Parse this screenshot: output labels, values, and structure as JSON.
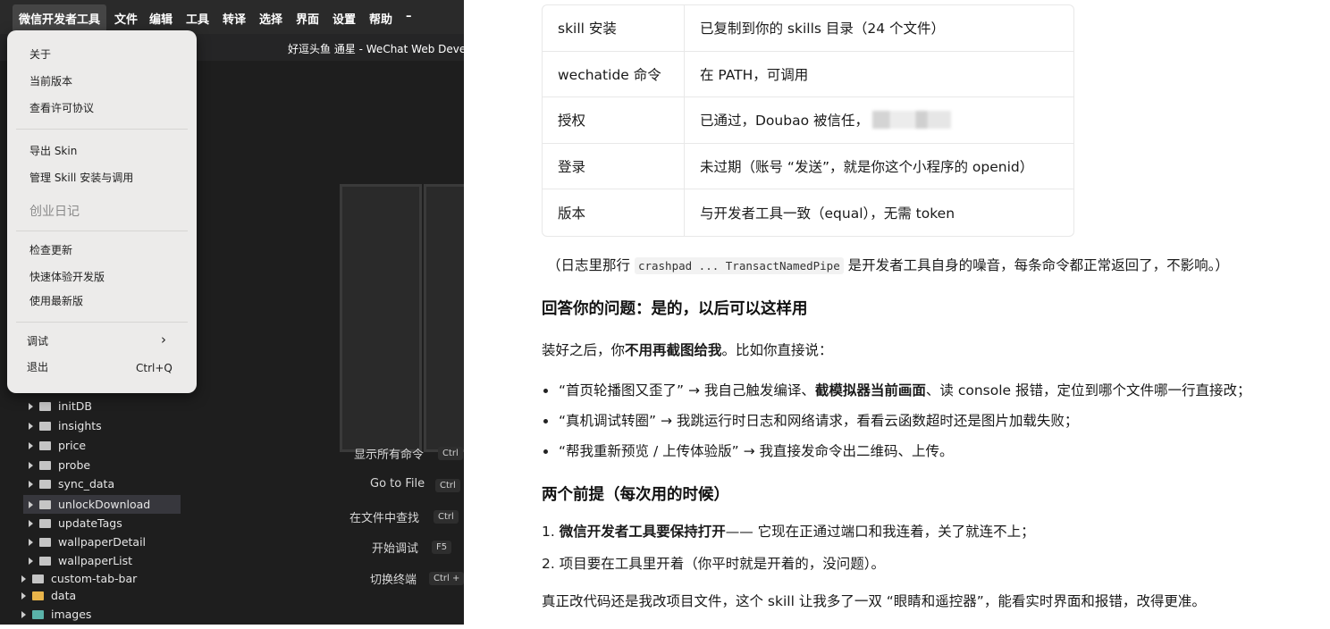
{
  "devtools": {
    "menubar": {
      "items": [
        "微信开发者工具",
        "文件",
        "编辑",
        "工具",
        "转译",
        "选择",
        "界面",
        "设置",
        "帮助",
        "–"
      ]
    },
    "window_title": "好逗头鱼 通星 - WeChat Web Devel",
    "dropdown": {
      "about": "关于",
      "current_version": "当前版本",
      "license": "查看许可协议",
      "export_skin": "导出 Skin",
      "manage_skill": "管理 Skill 安装与调用",
      "disabled_item": "创业日记",
      "check_updates": "检查更新",
      "quick_dev": "快速体验开发版",
      "use_latest": "使用最新版",
      "debug": "调试",
      "debug_arrow": "›",
      "quit": "退出",
      "quit_shortcut": "Ctrl+Q"
    },
    "commands": [
      {
        "label": "显示所有命令",
        "key": "Ctrl"
      },
      {
        "label": "Go to File",
        "key": "Ctrl"
      },
      {
        "label": "在文件中查找",
        "key": "Ctrl"
      },
      {
        "label": "开始调试",
        "key": "F5"
      },
      {
        "label": "切换终端",
        "key": "Ctrl +"
      }
    ],
    "file_tree": [
      "initDB",
      "insights",
      "price",
      "probe",
      "sync_data",
      "unlockDownload",
      "updateTags",
      "wallpaperDetail",
      "wallpaperList",
      "custom-tab-bar",
      "data",
      "images"
    ],
    "selected_item": "unlockDownload"
  },
  "chat": {
    "table": [
      {
        "key": "skill 安装",
        "value": "已复制到你的 skills 目录（24 个文件）"
      },
      {
        "key": "wechatide 命令",
        "value": "在 PATH，可调用"
      },
      {
        "key": "授权",
        "value": "已通过，Doubao 被信任，"
      },
      {
        "key": "登录",
        "value": "未过期（账号 “发送”，就是你这个小程序的 openid）"
      },
      {
        "key": "版本",
        "value": "与开发者工具一致（equal），无需 token"
      }
    ],
    "log_note": {
      "prefix": "（日志里那行",
      "code": "crashpad ... TransactNamedPipe",
      "suffix": "是开发者工具自身的噪音，每条命令都正常返回了，不影响。）"
    },
    "heading1": "回答你的问题：是的，以后可以这样用",
    "intro": {
      "a": "装好之后，你",
      "b": "不用再截图给我",
      "c": "。比如你直接说："
    },
    "bullets": [
      {
        "a": "“首页轮播图又歪了” → 我自己触发编译、",
        "b": "截模拟器当前画面",
        "c": "、读 console 报错，定位到哪个文件哪一行直接改；"
      },
      {
        "a": "“真机调试转圈” → 我跳运行时日志和网络请求，看看云函数超时还是图片加载失败；",
        "b": "",
        "c": ""
      },
      {
        "a": "“帮我重新预览 / 上传体验版” → 我直接发命令出二维码、上传。",
        "b": "",
        "c": ""
      }
    ],
    "heading2": "两个前提（每次用的时候）",
    "steps": [
      {
        "num": "1.",
        "bold": "微信开发者工具要保持打开",
        "rest": "—— 它现在正通过端口和我连着，关了就连不上；"
      },
      {
        "num": "2.",
        "bold": "",
        "rest": "项目要在工具里开着（你平时就是开着的，没问题）。"
      }
    ],
    "closing": "真正改代码还是我改项目文件，这个 skill 让我多了一双 “眼睛和遥控器”，能看实时界面和报错，改得更准。"
  }
}
